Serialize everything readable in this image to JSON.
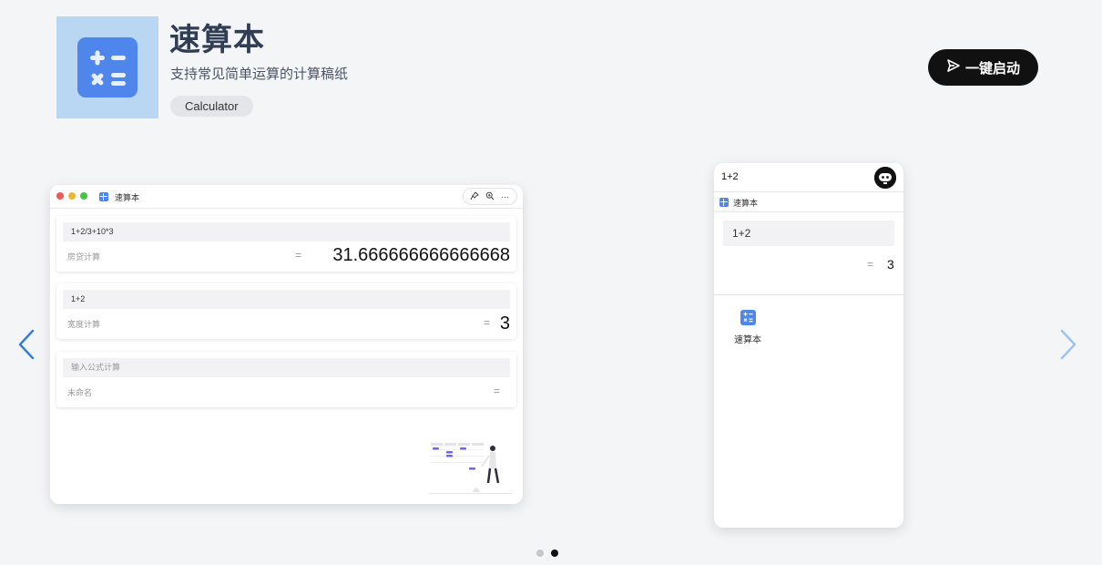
{
  "app": {
    "title": "速算本",
    "subtitle": "支持常见简单运算的计算稿纸",
    "tag": "Calculator",
    "launch_label": "一键启动",
    "icon": "calculator-icon"
  },
  "colors": {
    "accent": "#4f86ec",
    "icon_bg": "#b9d7f2",
    "button_bg": "#111111",
    "page_bg": "#f4f5f7"
  },
  "desktop_preview": {
    "title": "速算本",
    "tools": [
      "pin-icon",
      "zoom-icon",
      "more-icon"
    ],
    "cards": [
      {
        "expression": "1+2/3+10*3",
        "name": "房贷计算",
        "eq": "=",
        "result": "31.666666666666668"
      },
      {
        "expression": "1+2",
        "name": "宽度计算",
        "eq": "=",
        "result": "3"
      },
      {
        "placeholder": "输入公式计算",
        "name": "未命名",
        "eq": "=",
        "result": ""
      }
    ]
  },
  "mobile_preview": {
    "top_expression": "1+2",
    "subtitle": "速算本",
    "input": "1+2",
    "eq": "=",
    "result": "3",
    "app_label": "速算本"
  },
  "carousel": {
    "prev": "chevron-left-icon",
    "next": "chevron-right-icon",
    "pages": 2,
    "active_page": 2
  }
}
